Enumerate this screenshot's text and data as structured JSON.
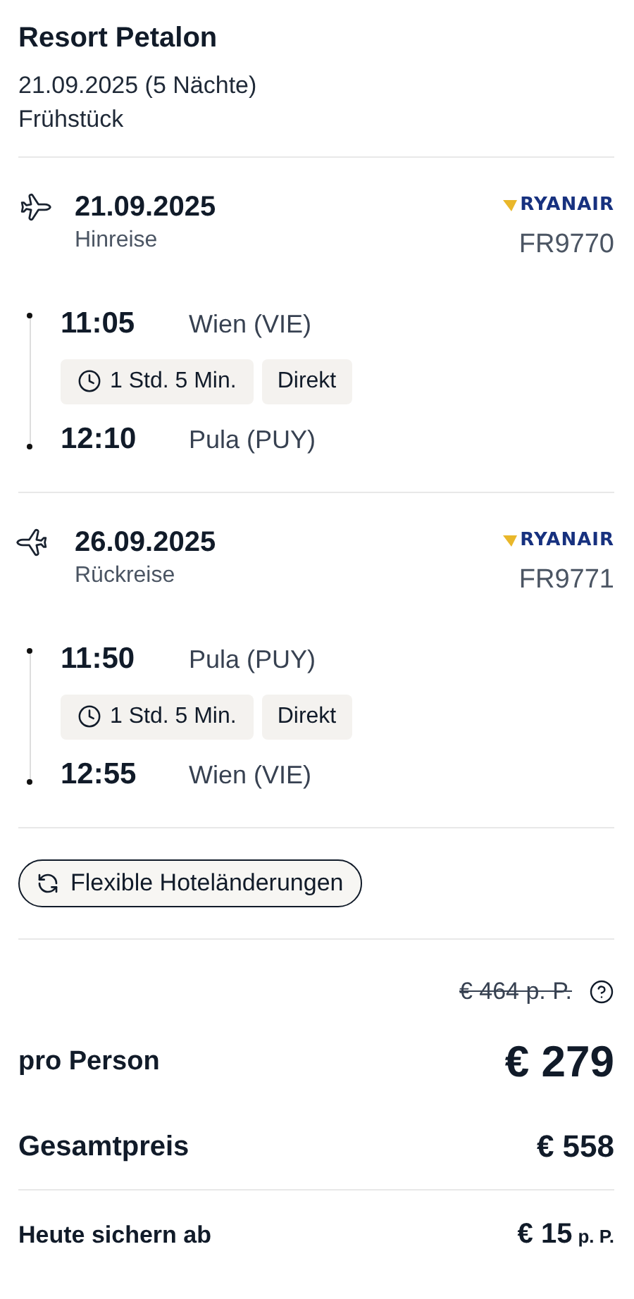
{
  "hotel": {
    "name": "Resort Petalon",
    "dates": "21.09.2025 (5 Nächte)",
    "board": "Frühstück"
  },
  "flights": [
    {
      "kind": "outbound",
      "date": "21.09.2025",
      "label": "Hinreise",
      "airline": "RYANAIR",
      "flight_no": "FR9770",
      "departure": {
        "time": "11:05",
        "airport": "Wien (VIE)"
      },
      "duration": "1 Std. 5 Min.",
      "stops": "Direkt",
      "arrival": {
        "time": "12:10",
        "airport": "Pula (PUY)"
      }
    },
    {
      "kind": "return",
      "date": "26.09.2025",
      "label": "Rückreise",
      "airline": "RYANAIR",
      "flight_no": "FR9771",
      "departure": {
        "time": "11:50",
        "airport": "Pula (PUY)"
      },
      "duration": "1 Std. 5 Min.",
      "stops": "Direkt",
      "arrival": {
        "time": "12:55",
        "airport": "Wien (VIE)"
      }
    }
  ],
  "feature_chip": "Flexible Hoteländerungen",
  "price": {
    "old_price": "€ 464 p. P.",
    "per_person_label": "pro Person",
    "per_person": "€ 279",
    "total_label": "Gesamtpreis",
    "total": "€ 558",
    "deposit_label": "Heute sichern ab",
    "deposit": "€ 15",
    "deposit_unit": "p. P."
  }
}
